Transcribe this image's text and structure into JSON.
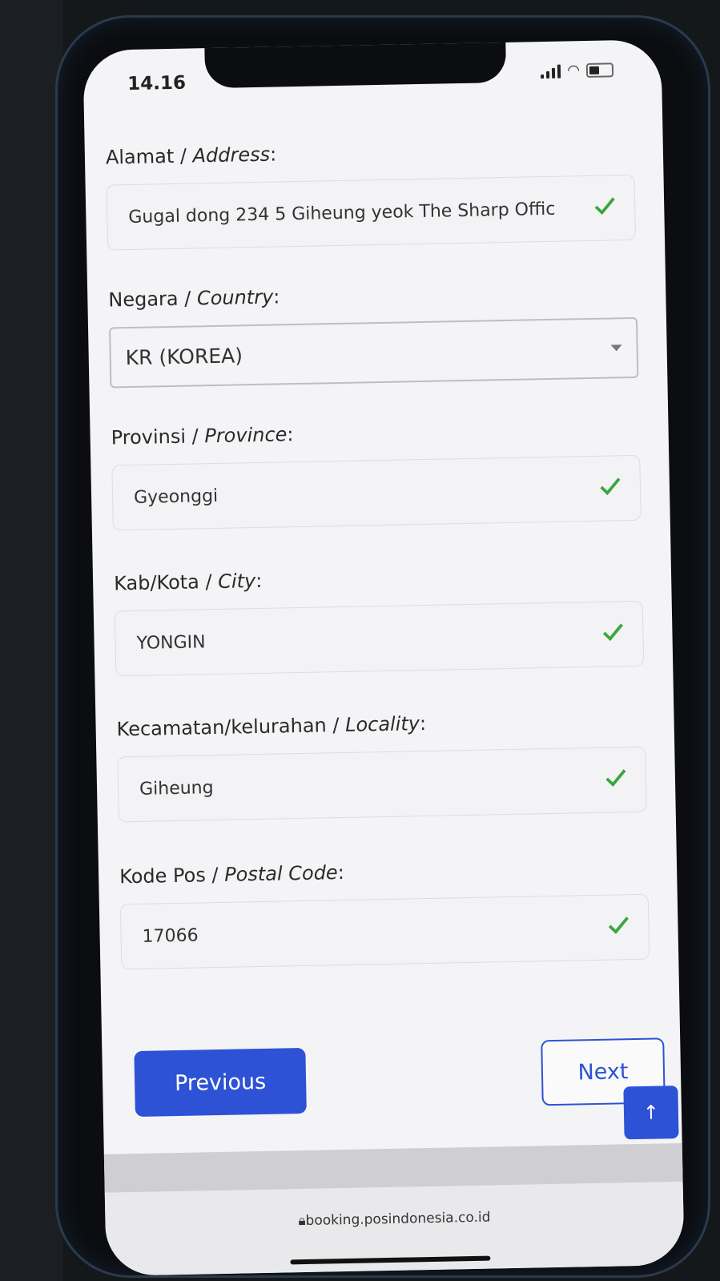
{
  "status": {
    "time": "14.16"
  },
  "fields": {
    "address": {
      "label": "Alamat",
      "label_en": "Address",
      "value": "Gugal dong 234 5 Giheung yeok The Sharp Offic"
    },
    "country": {
      "label": "Negara",
      "label_en": "Country",
      "value": "KR (KOREA)"
    },
    "province": {
      "label": "Provinsi",
      "label_en": "Province",
      "value": "Gyeonggi"
    },
    "city": {
      "label": "Kab/Kota",
      "label_en": "City",
      "value": "YONGIN"
    },
    "locality": {
      "label": "Kecamatan/kelurahan",
      "label_en": "Locality",
      "value": "Giheung"
    },
    "postal": {
      "label": "Kode Pos",
      "label_en": "Postal Code",
      "value": "17066"
    }
  },
  "buttons": {
    "previous": "Previous",
    "next": "Next",
    "scroll_top": "↑"
  },
  "browser": {
    "url": "booking.posindonesia.co.id"
  },
  "colors": {
    "primary": "#2e52d6",
    "check": "#3aa63c"
  }
}
